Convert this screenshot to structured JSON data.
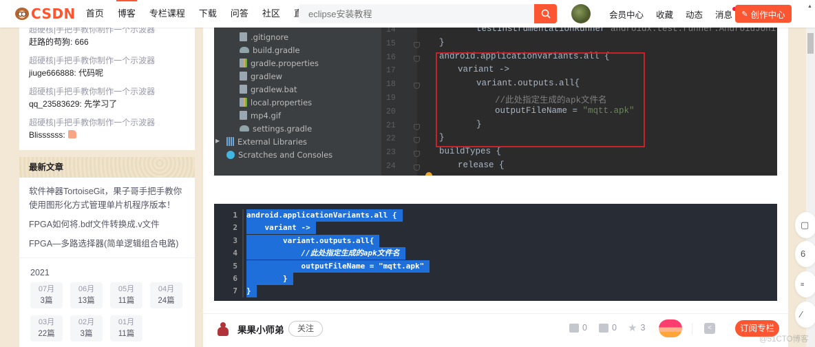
{
  "header": {
    "logo_text": "CSDN",
    "nav": [
      "首页",
      "博客",
      "专栏课程",
      "下载",
      "问答",
      "社区",
      "直播"
    ],
    "nav_active_index": 1,
    "nav_dropdown_chevron": "⌄",
    "search_placeholder": "eclipse安装教程",
    "search_icon": "search-icon",
    "right_nav": [
      "会员中心",
      "收藏",
      "动态",
      "消息"
    ],
    "create_button": "创作中心",
    "create_icon": "pen-icon",
    "brand_color": "#fc5531"
  },
  "sidebar": {
    "comments": [
      {
        "title": "超硬核|手把手教你制作一个示波器",
        "text": "赶路的苟狗: 666"
      },
      {
        "title": "超硬核|手把手教你制作一个示波器",
        "text": "jiuge666888: 代码呢"
      },
      {
        "title": "超硬核|手把手教你制作一个示波器",
        "text": "qq_23583629: 先学习了"
      },
      {
        "title": "超硬核|手把手教你制作一个示波器",
        "text": "Blissssss:"
      }
    ],
    "recent_title": "最新文章",
    "recent_articles": [
      "软件神器TortoiseGit，果子哥手把手教你使用图形化方式管理单片机程序版本！",
      "FPGA如何将.bdf文件转换成.v文件",
      "FPGA—多路选择器(简单逻辑组合电路)"
    ],
    "archive": {
      "year": "2021",
      "months": [
        {
          "month": "07月",
          "count": "3篇"
        },
        {
          "month": "06月",
          "count": "13篇"
        },
        {
          "month": "05月",
          "count": "11篇"
        },
        {
          "month": "04月",
          "count": "24篇"
        },
        {
          "month": "03月",
          "count": "22篇"
        },
        {
          "month": "02月",
          "count": "3篇"
        },
        {
          "month": "01月",
          "count": "11篇"
        }
      ]
    }
  },
  "ide_screenshot": {
    "tree": [
      ".gitignore",
      "build.gradle",
      "gradle.properties",
      "gradlew",
      "gradlew.bat",
      "local.properties",
      "mp4.gif",
      "settings.gradle",
      "External Libraries",
      "Scratches and Consoles"
    ],
    "line_numbers": [
      "14",
      "15",
      "16",
      "17",
      "18",
      "19",
      "20",
      "21",
      "22",
      "23",
      "24"
    ],
    "lines": [
      {
        "indent": 2,
        "text": "testInstrumentationRunner ",
        "extra": "androidx.test.runner.AndroidJUnitRunner"
      },
      {
        "indent": 0,
        "text": "}"
      },
      {
        "indent": 0,
        "text": "android.applicationVariants.all {"
      },
      {
        "indent": 1,
        "text": "variant ->"
      },
      {
        "indent": 2,
        "text": "variant.outputs.all{"
      },
      {
        "indent": 3,
        "comment": "//此处指定生成的apk文件名"
      },
      {
        "indent": 3,
        "text": "outputFileName = ",
        "string": "\"mqtt.apk\""
      },
      {
        "indent": 2,
        "text": "}"
      },
      {
        "indent": 0,
        "text": "}"
      },
      {
        "indent": 0,
        "text": "buildTypes {"
      },
      {
        "indent": 1,
        "text": "release {"
      }
    ]
  },
  "code_snippet": {
    "lines": [
      {
        "n": "1",
        "text": "android.applicationVariants.all {"
      },
      {
        "n": "2",
        "text": "    variant ->"
      },
      {
        "n": "3",
        "text": "        variant.outputs.all{"
      },
      {
        "n": "4",
        "text": "            //此处指定生成的apk文件名"
      },
      {
        "n": "5",
        "text": "            outputFileName = \"mqtt.apk\""
      },
      {
        "n": "6",
        "text": "        }"
      },
      {
        "n": "7",
        "text": "}"
      }
    ],
    "selection_color": "#1e6fd9"
  },
  "footer": {
    "author": "果果小师弟",
    "follow": "关注",
    "likes": "0",
    "comments": "0",
    "favorites": "3",
    "subscribe": "订阅专栏"
  },
  "watermark": "@51CTO博客",
  "float_buttons": [
    "▢",
    "6",
    "≡",
    "∕"
  ]
}
